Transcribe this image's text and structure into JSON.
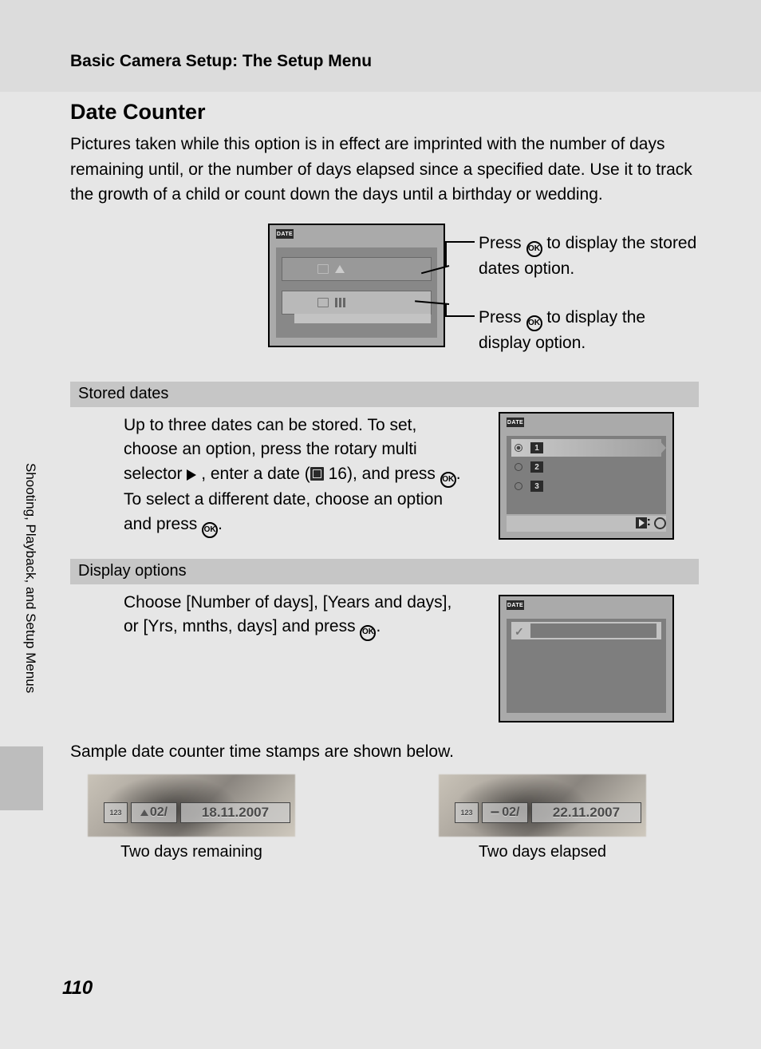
{
  "header": {
    "breadcrumb": "Basic Camera Setup: The Setup Menu"
  },
  "title": "Date Counter",
  "intro": "Pictures taken while this option is in effect are imprinted with the number of days remaining until, or the number of days elapsed since a specified date. Use it to track the growth of a child or count down the days until a birthday or wedding.",
  "lcd_label": "DATE",
  "annotations": {
    "a1_pre": "Press ",
    "a1_post": " to display the stored dates option.",
    "a2_pre": "Press ",
    "a2_post": " to display the display option."
  },
  "ok_glyph": "OK",
  "sections": {
    "stored": {
      "heading": "Stored dates",
      "body_pre": "Up to three dates can be stored. To set, choose an option, press the rotary multi selector ",
      "body_mid1": " , enter a date (",
      "page_ref": " 16), and press ",
      "body_mid2": ". To select a different date, choose an option and press ",
      "body_end": ".",
      "digits": [
        "1",
        "2",
        "3"
      ],
      "footer_colon": ":"
    },
    "display": {
      "heading": "Display options",
      "body_pre": "Choose [Number of days], [Years and days], or [Yrs, mnths, days] and press ",
      "body_end": "."
    }
  },
  "samples": {
    "intro": "Sample date counter time stamps are shown below.",
    "s1": {
      "num": "02/",
      "date": "18.11.2007",
      "caption": "Two days remaining",
      "mode": "123"
    },
    "s2": {
      "num": "02/",
      "date": "22.11.2007",
      "caption": "Two days elapsed",
      "mode": "123"
    }
  },
  "side_label": "Shooting, Playback, and Setup Menus",
  "page_number": "110"
}
